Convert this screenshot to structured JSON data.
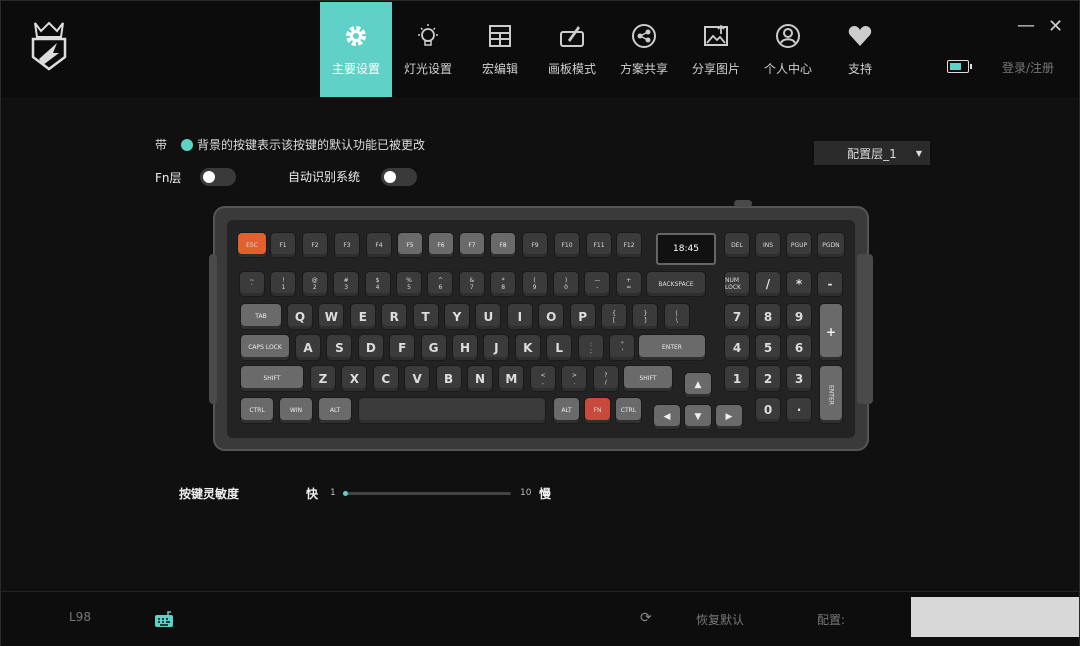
{
  "nav": {
    "tabs": [
      {
        "label": "主要设置",
        "icon": "gear-icon",
        "active": true
      },
      {
        "label": "灯光设置",
        "icon": "bulb-icon",
        "active": false
      },
      {
        "label": "宏编辑",
        "icon": "table-icon",
        "active": false
      },
      {
        "label": "画板模式",
        "icon": "drawing-board-icon",
        "active": false
      },
      {
        "label": "方案共享",
        "icon": "share-scheme-icon",
        "active": false
      },
      {
        "label": "分享图片",
        "icon": "share-image-icon",
        "active": false
      },
      {
        "label": "个人中心",
        "icon": "user-icon",
        "active": false
      },
      {
        "label": "支持",
        "icon": "heart-icon",
        "active": false
      }
    ],
    "login": "登录/注册",
    "battery_level": 0.7
  },
  "legend": {
    "prefix": "带",
    "text": "背景的按键表示该按键的默认功能已被更改",
    "color": "#5fd1c6"
  },
  "fn_layer": {
    "label": "Fn层",
    "on": false
  },
  "auto_detect": {
    "label": "自动识别系统",
    "on": false
  },
  "profile": {
    "selected": "配置层_1"
  },
  "keyboard": {
    "screen_time": "18:45",
    "keys": {
      "esc": "ESC",
      "f1": "F1",
      "f2": "F2",
      "f3": "F3",
      "f4": "F4",
      "f5": "F5",
      "f6": "F6",
      "f7": "F7",
      "f8": "F8",
      "f9": "F9",
      "f10": "F10",
      "f11": "F11",
      "f12": "F12",
      "del": "DEL",
      "ins": "INS",
      "pgup": "PGUP",
      "pgdn": "PGDN",
      "backspace": "BACKSPACE",
      "numlock": "NUM LOCK",
      "tab": "TAB",
      "capslock": "CAPS LOCK",
      "enter": "ENTER",
      "lshift": "SHIFT",
      "rshift": "SHIFT",
      "lctrl": "CTRL",
      "win": "WIN",
      "lalt": "ALT",
      "ralt": "ALT",
      "fn": "FN",
      "rctrl": "CTRL",
      "numenter": "ENTER"
    },
    "num_row": [
      [
        "~",
        "`"
      ],
      [
        "!",
        "1"
      ],
      [
        "@",
        "2"
      ],
      [
        "#",
        "3"
      ],
      [
        "$",
        "4"
      ],
      [
        "%",
        "5"
      ],
      [
        "^",
        "6"
      ],
      [
        "&",
        "7"
      ],
      [
        "*",
        "8"
      ],
      [
        "(",
        "9"
      ],
      [
        ")",
        "0"
      ],
      [
        "—",
        "-"
      ],
      [
        "+",
        "="
      ]
    ],
    "qwerty": [
      "Q",
      "W",
      "E",
      "R",
      "T",
      "Y",
      "U",
      "I",
      "O",
      "P"
    ],
    "qwerty_sym": [
      [
        "{",
        "["
      ],
      [
        "}",
        "]"
      ],
      [
        "|",
        "\\"
      ]
    ],
    "asdf": [
      "A",
      "S",
      "D",
      "F",
      "G",
      "H",
      "J",
      "K",
      "L"
    ],
    "asdf_sym": [
      [
        ":",
        ";"
      ],
      [
        "\"",
        "'"
      ]
    ],
    "zxcv": [
      "Z",
      "X",
      "C",
      "V",
      "B",
      "N",
      "M"
    ],
    "zxcv_sym": [
      [
        "<",
        ","
      ],
      [
        ">",
        "."
      ],
      [
        "?",
        "/"
      ]
    ],
    "numpad_top": [
      "/",
      "*",
      "-"
    ],
    "numpad_plus": "+",
    "numpad_rows": [
      [
        "7",
        "8",
        "9"
      ],
      [
        "4",
        "5",
        "6"
      ],
      [
        "1",
        "2",
        "3"
      ]
    ],
    "numpad_zero": "0",
    "numpad_dot": "·"
  },
  "sensitivity": {
    "label": "按键灵敏度",
    "fast": "快",
    "slow": "慢",
    "min": "1",
    "max": "10",
    "value": 1
  },
  "footer": {
    "device": "L98",
    "restore": "恢复默认",
    "config": "配置:"
  }
}
